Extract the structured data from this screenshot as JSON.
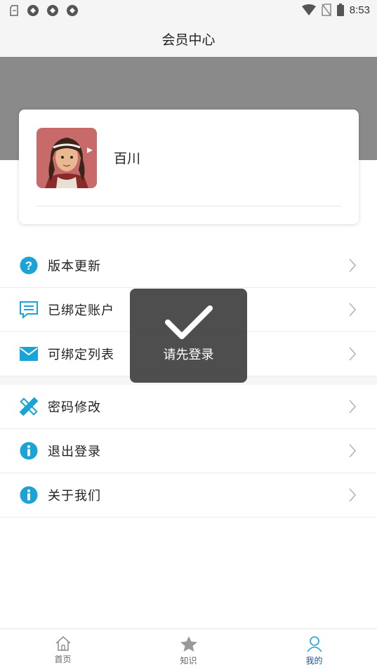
{
  "status_bar": {
    "time": "8:53"
  },
  "header": {
    "title": "会员中心"
  },
  "profile": {
    "username": "百川"
  },
  "menu": {
    "group1": [
      {
        "label": "版本更新",
        "icon": "question-circle-icon"
      },
      {
        "label": "已绑定账户",
        "icon": "message-icon"
      },
      {
        "label": "可绑定列表",
        "icon": "mail-icon"
      }
    ],
    "group2": [
      {
        "label": "密码修改",
        "icon": "tools-icon"
      },
      {
        "label": "退出登录",
        "icon": "info-circle-icon"
      },
      {
        "label": "关于我们",
        "icon": "info-circle-icon"
      }
    ]
  },
  "toast": {
    "message": "请先登录",
    "icon": "check-icon"
  },
  "tab_bar": {
    "tabs": [
      {
        "label": "首页",
        "icon": "home-icon"
      },
      {
        "label": "知识",
        "icon": "star-icon"
      },
      {
        "label": "我的",
        "icon": "user-icon",
        "active": true
      }
    ]
  },
  "colors": {
    "accent": "#1aa3d6",
    "active_tab": "#1d4f91",
    "banner": "#8a8a8a",
    "toast_bg": "#444444"
  }
}
